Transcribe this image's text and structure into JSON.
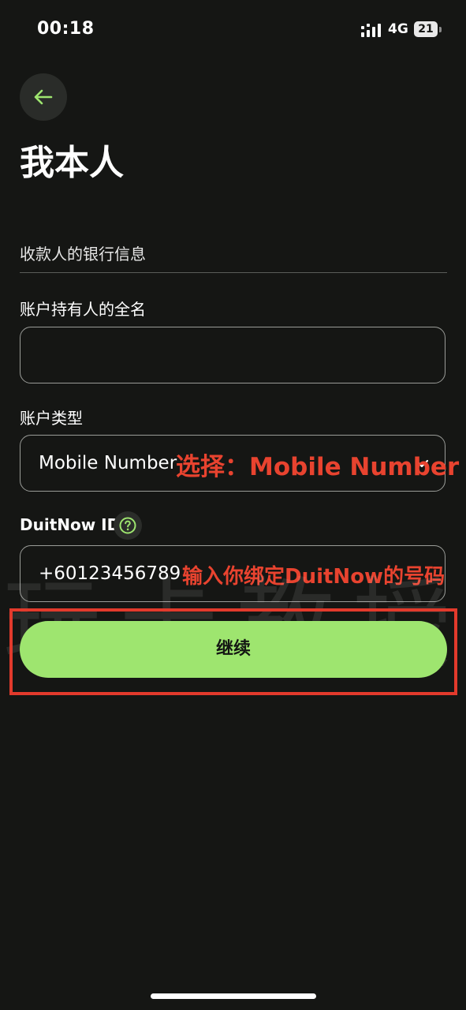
{
  "status_bar": {
    "time": "00:18",
    "network": "4G",
    "battery": "21"
  },
  "header": {
    "title": "我本人"
  },
  "form": {
    "section_heading": "收款人的银行信息",
    "holder_name": {
      "label": "账户持有人的全名",
      "value": ""
    },
    "account_type": {
      "label": "账户类型",
      "value": "Mobile Number"
    },
    "duitnow": {
      "label": "DuitNow ID",
      "value": "+60123456789"
    },
    "continue_label": "继续"
  },
  "annotations": {
    "account_type_note": "选择：Mobile Number",
    "duitnow_note": "输入你绑定DuitNow的号码"
  },
  "watermark": "玩卡教授",
  "colors": {
    "background": "#151614",
    "accent": "#9ee56f",
    "annotation": "#e8432f"
  }
}
